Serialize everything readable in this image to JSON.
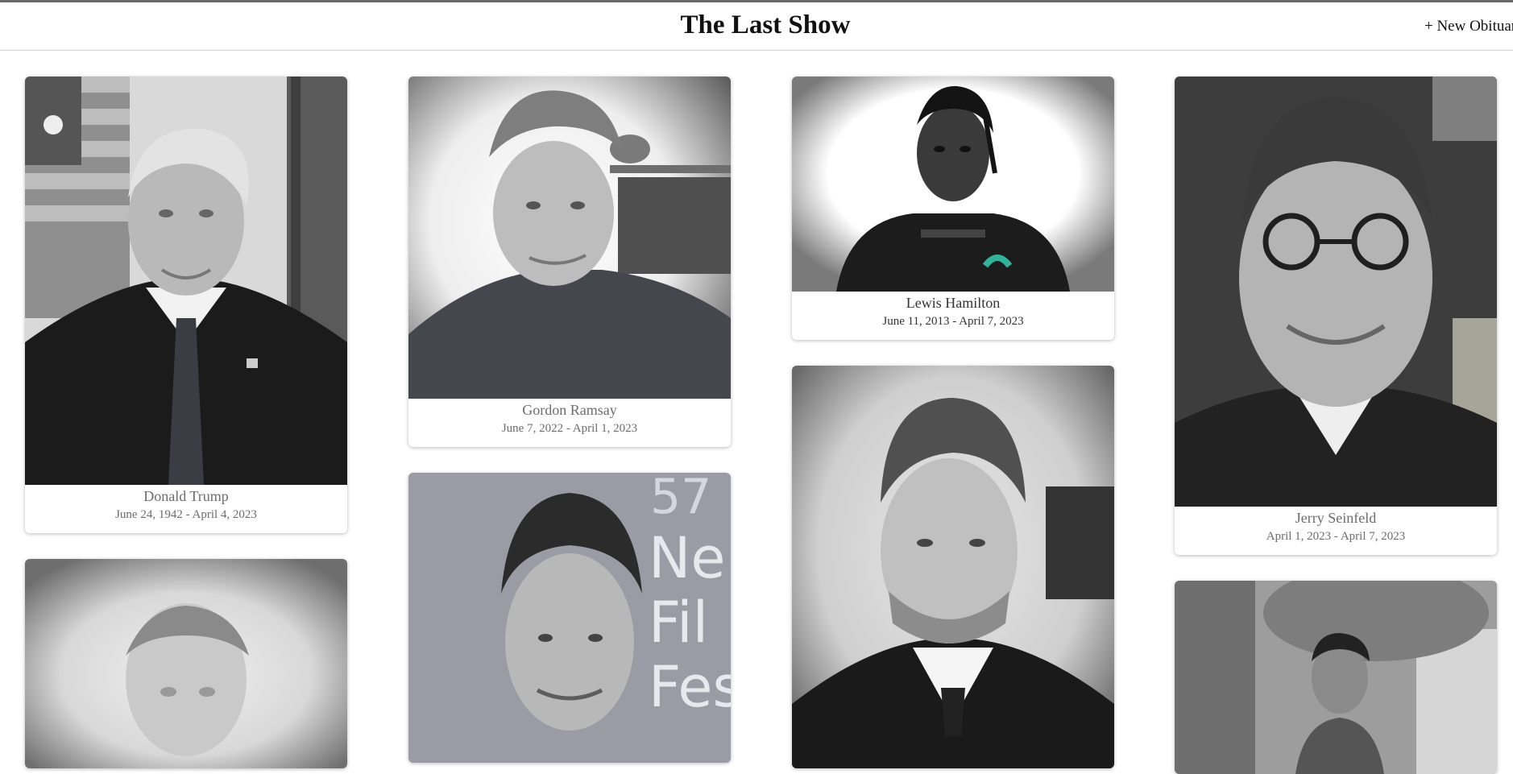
{
  "app": {
    "title": "The Last Show",
    "new_button_label": "+ New Obituary"
  },
  "obituaries": [
    {
      "name": "Donald Trump",
      "dates": "June 24, 1942 - April 4, 2023"
    },
    {
      "name": "Gordon Ramsay",
      "dates": "June 7, 2022 - April 1, 2023"
    },
    {
      "name": "Lewis Hamilton",
      "dates": "June 11, 2013 - April 7, 2023"
    },
    {
      "name": "Jerry Seinfeld",
      "dates": "April 1, 2023 - April 7, 2023"
    }
  ],
  "photo_text": {
    "film_fest_sign": [
      "57",
      "Ne",
      "Fil",
      "Fes"
    ]
  }
}
